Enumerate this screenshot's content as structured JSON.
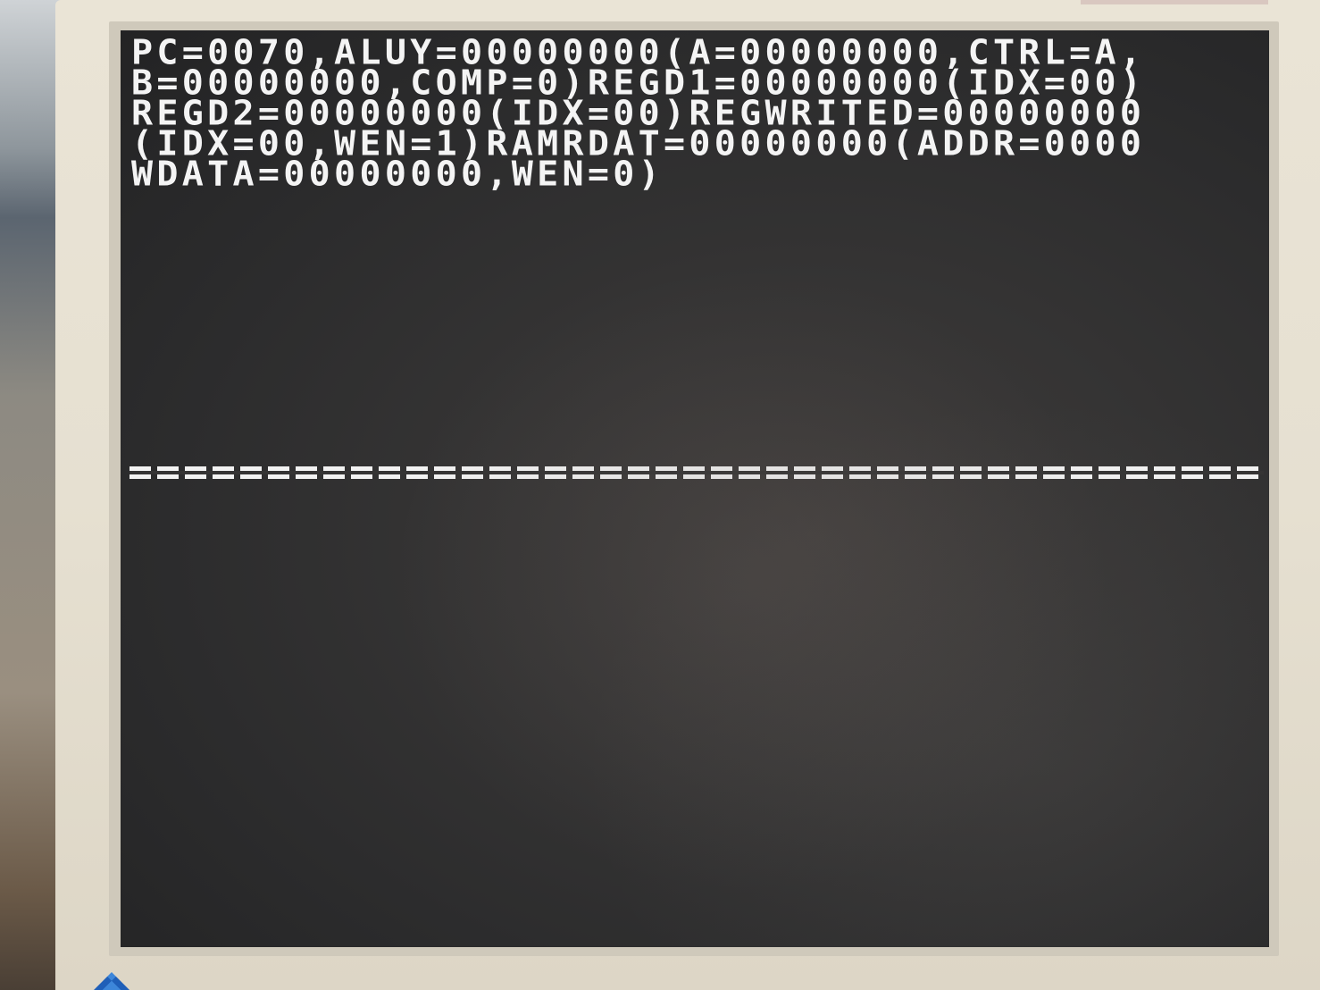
{
  "terminal": {
    "lines": [
      "PC=0070,ALUY=00000000(A=00000000,CTRL=A,",
      "B=00000000,COMP=0)REGD1=00000000(IDX=00)",
      "REGD2=00000000(IDX=00)REGWRITED=00000000",
      "(IDX=00,WEN=1)RAMRDAT=00000000(ADDR=0000",
      "WDATA=00000000,WEN=0)"
    ],
    "separator": "========================================"
  },
  "colors": {
    "screen_background": "#2e2e2f",
    "text": "#f4f4f4",
    "bezel": "#e6e0d1"
  }
}
